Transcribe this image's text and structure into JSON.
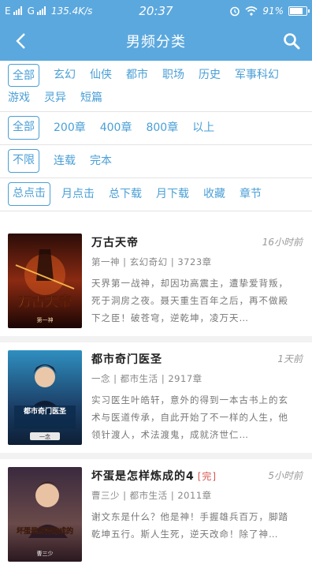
{
  "status": {
    "net": "E",
    "carrier": "G",
    "speed": "135.4K/s",
    "time": "20:37",
    "battery": "91%",
    "battery_level": 0.91
  },
  "header": {
    "title": "男频分类"
  },
  "filters": {
    "category": [
      "全部",
      "玄幻",
      "仙侠",
      "都市",
      "职场",
      "历史",
      "军事",
      "科幻",
      "游戏",
      "灵异",
      "短篇"
    ],
    "chapters": [
      "全部",
      "200章",
      "400章",
      "800章",
      "以上"
    ],
    "status": [
      "不限",
      "连载",
      "完本"
    ],
    "sort": [
      "总点击",
      "月点击",
      "总下载",
      "月下载",
      "收藏",
      "章节"
    ]
  },
  "books": [
    {
      "title": "万古天帝",
      "time": "16小时前",
      "meta": "第一神 | 玄幻奇幻 | 3723章",
      "desc": "天界第一战神，却因功高震主，遭挚爱背叛，死于洞房之夜。聂天重生百年之后，再不做殿下之臣！破苍穹，逆乾坤，凌万天…",
      "cover_text": "万古天帝",
      "cover_author": "第一神",
      "done": ""
    },
    {
      "title": "都市奇门医圣",
      "time": "1天前",
      "meta": "一念 | 都市生活 | 2917章",
      "desc": "实习医生叶皓轩，意外的得到一本古书上的玄术与医道传承，自此开始了不一样的人生，他领针渡人，术法渡鬼，成就济世仁…",
      "cover_text": "都市奇门医圣",
      "cover_author": "一念",
      "done": ""
    },
    {
      "title": "坏蛋是怎样炼成的4",
      "time": "5小时前",
      "meta": "曹三少 | 都市生活 | 2011章",
      "desc": "谢文东是什么？他是神！手握雄兵百万，脚踏乾坤五行。斯人生死，逆天改命！除了神…",
      "cover_text": "坏蛋是怎样炼成的",
      "cover_author": "曹三少",
      "done": "[完]"
    }
  ]
}
